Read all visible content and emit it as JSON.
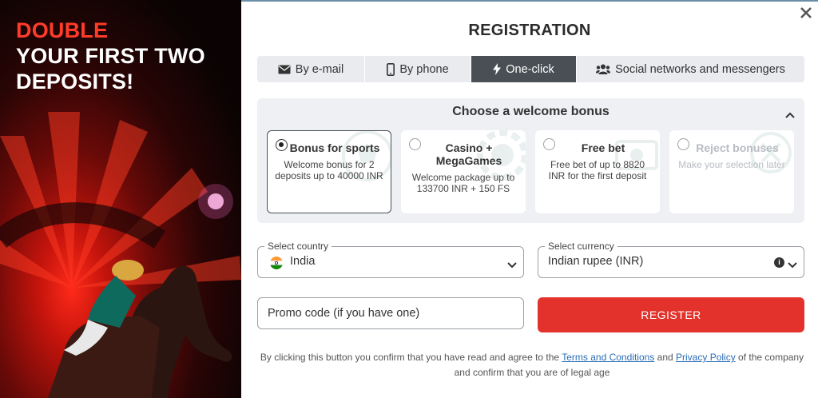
{
  "promo": {
    "headline_accent": "DOUBLE",
    "headline_line2": "YOUR FIRST TWO",
    "headline_line3": "DEPOSITS!"
  },
  "dialog": {
    "title": "REGISTRATION",
    "close_icon": "close-icon"
  },
  "tabs": [
    {
      "label": "By e-mail",
      "icon": "envelope-icon",
      "active": false
    },
    {
      "label": "By phone",
      "icon": "phone-icon",
      "active": false
    },
    {
      "label": "One-click",
      "icon": "lightning-icon",
      "active": true
    },
    {
      "label": "Social networks and messengers",
      "icon": "users-icon",
      "active": false
    }
  ],
  "bonus": {
    "heading": "Choose a welcome bonus",
    "options": [
      {
        "title": "Bonus for sports",
        "desc": "Welcome bonus for 2 deposits up to 40000 INR",
        "selected": true
      },
      {
        "title": "Casino + MegaGames",
        "desc": "Welcome package up to 133700 INR + 150 FS",
        "selected": false
      },
      {
        "title": "Free bet",
        "desc": "Free bet of up to 8820 INR for the first deposit",
        "selected": false
      },
      {
        "title": "Reject bonuses",
        "desc": "Make your selection later",
        "selected": false
      }
    ]
  },
  "country": {
    "label": "Select country",
    "value": "India"
  },
  "currency": {
    "label": "Select currency",
    "value": "Indian rupee (INR)"
  },
  "promo_code": {
    "placeholder": "Promo code (if you have one)"
  },
  "register": {
    "label": "REGISTER"
  },
  "legal": {
    "part1": "By clicking this button you confirm that you have read and agree to the",
    "terms_link": "Terms and Conditions",
    "and": "and",
    "privacy_link": "Privacy Policy",
    "part2": "of the company and confirm that you are of legal age"
  },
  "colors": {
    "accent_red": "#e3322b",
    "tab_active": "#4a4f55",
    "link": "#2a6db5"
  }
}
